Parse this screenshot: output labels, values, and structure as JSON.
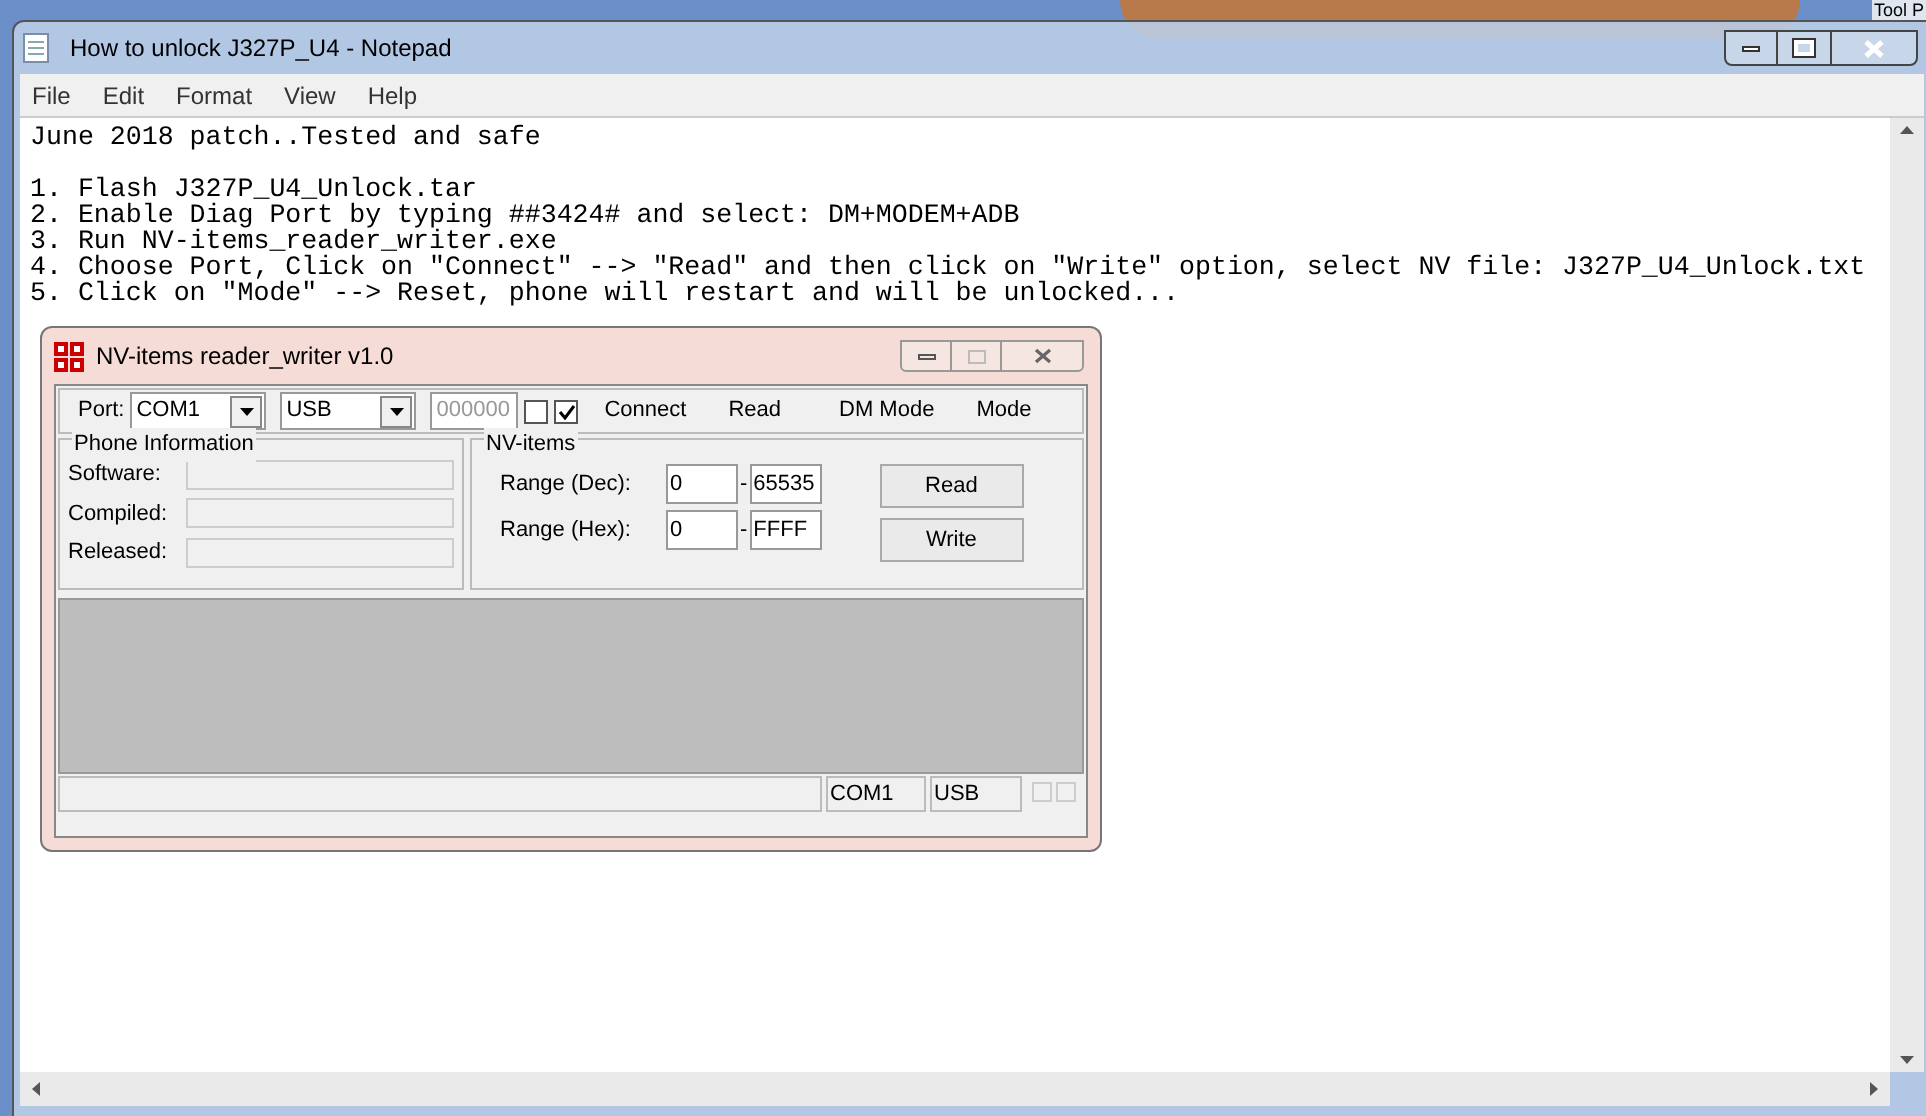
{
  "desktop": {
    "corner_text": "Tool P"
  },
  "notepad": {
    "title": "How to unlock J327P_U4 - Notepad",
    "menu": [
      "File",
      "Edit",
      "Format",
      "View",
      "Help"
    ],
    "lines": [
      "June 2018 patch..Tested and safe",
      "1. Flash J327P_U4_Unlock.tar",
      "2. Enable Diag Port by typing ##3424# and select: DM+MODEM+ADB",
      "3. Run NV-items_reader_writer.exe",
      "4. Choose Port, Click on \"Connect\" --> \"Read\" and then click on \"Write\" option, select NV file: J327P_U4_Unlock.txt",
      "5. Click on \"Mode\" --> Reset, phone will restart and will be unlocked..."
    ]
  },
  "dialog": {
    "title": "NV-items reader_writer v1.0",
    "toolbar": {
      "port_label": "Port:",
      "port": "COM1",
      "connection": "USB",
      "code": "000000",
      "checkboxes": [
        {
          "checked": false
        },
        {
          "checked": true
        }
      ],
      "buttons": [
        "Connect",
        "Read",
        "DM Mode",
        "Mode"
      ]
    },
    "phone_info": {
      "title": "Phone Information",
      "fields": [
        {
          "label": "Software:"
        },
        {
          "label": "Compiled:"
        },
        {
          "label": "Released:"
        }
      ]
    },
    "nv_items": {
      "title": "NV-items",
      "ranges": [
        {
          "label": "Range (Dec):",
          "from": "0",
          "separator": "-",
          "to": "65535"
        },
        {
          "label": "Range (Hex):",
          "from": "0",
          "separator": "-",
          "to": "FFFF"
        }
      ],
      "buttons": [
        "Read",
        "Write"
      ]
    },
    "status_bar": {
      "port": "COM1",
      "connection": "USB"
    }
  }
}
